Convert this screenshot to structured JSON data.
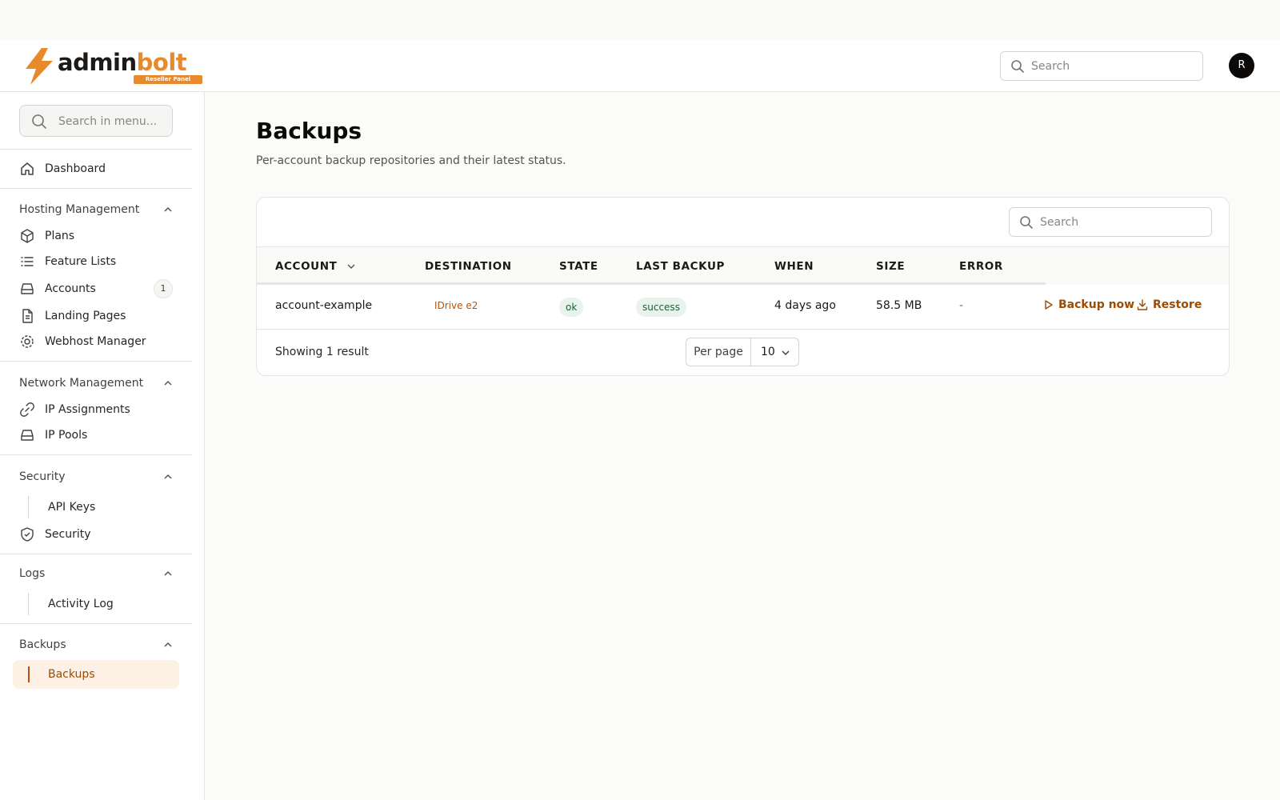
{
  "header": {
    "logo_text_a": "admin",
    "logo_text_b": "bolt",
    "logo_badge": "Reseller Panel",
    "search_placeholder": "Search",
    "avatar_initial": "R"
  },
  "sidebar": {
    "search_placeholder": "Search in menu...",
    "dashboard": "Dashboard",
    "groups": {
      "hosting": "Hosting Management",
      "network": "Network Management",
      "security": "Security",
      "logs": "Logs",
      "backups": "Backups"
    },
    "items": {
      "plans": "Plans",
      "feature_lists": "Feature Lists",
      "accounts": "Accounts",
      "accounts_count": "1",
      "landing_pages": "Landing Pages",
      "webhost_manager": "Webhost Manager",
      "ip_assignments": "IP Assignments",
      "ip_pools": "IP Pools",
      "api_keys": "API Keys",
      "security": "Security",
      "activity_log": "Activity Log",
      "backups": "Backups"
    }
  },
  "main": {
    "title": "Backups",
    "subtitle": "Per-account backup repositories and their latest status.",
    "table": {
      "search_placeholder": "Search",
      "columns": [
        "ACCOUNT",
        "DESTINATION",
        "STATE",
        "LAST BACKUP",
        "WHEN",
        "SIZE",
        "ERROR"
      ],
      "rows": [
        {
          "account": "account-example",
          "destination": "IDrive e2",
          "state": "ok",
          "last_backup": "success",
          "when": "4 days ago",
          "size": "58.5 MB",
          "error": "-",
          "action_backup": "Backup now",
          "action_restore": "Restore"
        }
      ],
      "footer": "Showing 1 result",
      "per_page_label": "Per page",
      "per_page_value": "10"
    }
  },
  "colors": {
    "accent": "#e8892b",
    "action": "#9a4d07",
    "success_bg": "#e7f3ec",
    "success_text": "#166534"
  }
}
